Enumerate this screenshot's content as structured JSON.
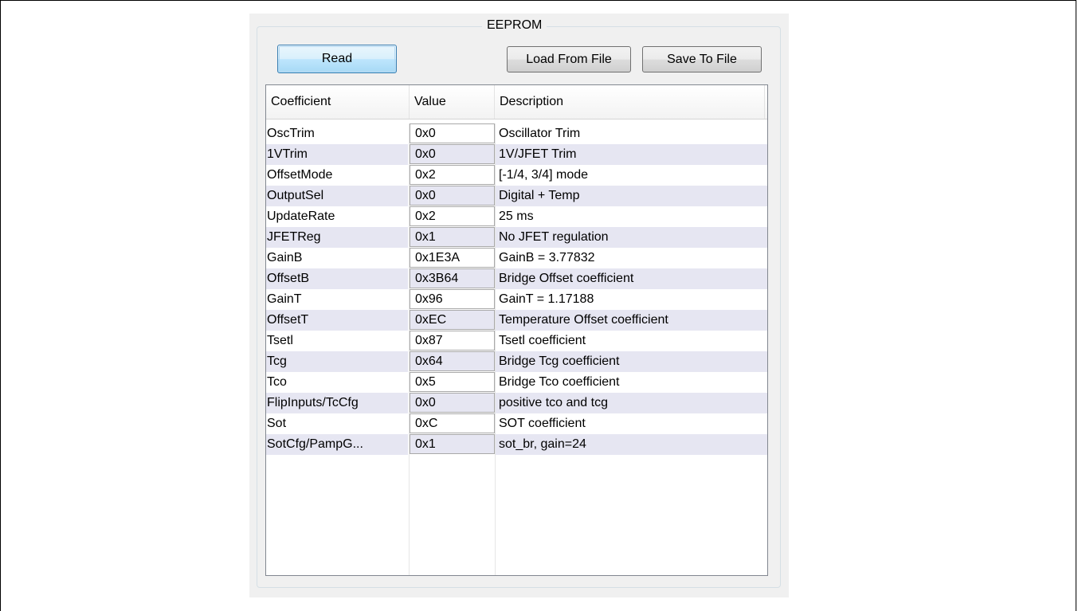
{
  "groupbox": {
    "title": "EEPROM"
  },
  "toolbar": {
    "read_label": "Read",
    "load_label": "Load From File",
    "save_label": "Save To File"
  },
  "table": {
    "columns": [
      "Coefficient",
      "Value",
      "Description"
    ],
    "rows": [
      {
        "coefficient": "OscTrim",
        "value": "0x0",
        "description": "Oscillator Trim"
      },
      {
        "coefficient": "1VTrim",
        "value": "0x0",
        "description": "1V/JFET Trim"
      },
      {
        "coefficient": "OffsetMode",
        "value": "0x2",
        "description": "[-1/4, 3/4] mode"
      },
      {
        "coefficient": "OutputSel",
        "value": "0x0",
        "description": "Digital + Temp"
      },
      {
        "coefficient": "UpdateRate",
        "value": "0x2",
        "description": "25 ms"
      },
      {
        "coefficient": "JFETReg",
        "value": "0x1",
        "description": "No JFET regulation"
      },
      {
        "coefficient": "GainB",
        "value": "0x1E3A",
        "description": "GainB = 3.77832"
      },
      {
        "coefficient": "OffsetB",
        "value": "0x3B64",
        "description": "Bridge Offset coefficient"
      },
      {
        "coefficient": "GainT",
        "value": "0x96",
        "description": "GainT = 1.17188"
      },
      {
        "coefficient": "OffsetT",
        "value": "0xEC",
        "description": "Temperature Offset coefficient"
      },
      {
        "coefficient": "Tsetl",
        "value": "0x87",
        "description": "Tsetl coefficient"
      },
      {
        "coefficient": "Tcg",
        "value": "0x64",
        "description": "Bridge Tcg coefficient"
      },
      {
        "coefficient": "Tco",
        "value": "0x5",
        "description": "Bridge Tco coefficient"
      },
      {
        "coefficient": "FlipInputs/TcCfg",
        "value": "0x0",
        "description": "positive tco and tcg"
      },
      {
        "coefficient": "Sot",
        "value": "0xC",
        "description": "SOT coefficient"
      },
      {
        "coefficient": "SotCfg/PampG...",
        "value": "0x1",
        "description": "sot_br, gain=24"
      }
    ]
  }
}
